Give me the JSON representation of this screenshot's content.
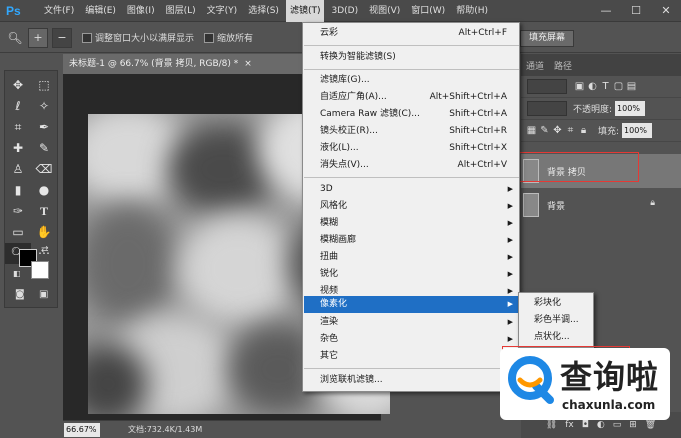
{
  "menubar": {
    "logo": "Ps",
    "items": [
      "文件(F)",
      "编辑(E)",
      "图像(I)",
      "图层(L)",
      "文字(Y)",
      "选择(S)",
      "滤镜(T)",
      "3D(D)",
      "视图(V)",
      "窗口(W)",
      "帮助(H)"
    ],
    "active_index": 6,
    "win_min": "—",
    "win_max": "☐",
    "win_close": "✕"
  },
  "optbar": {
    "resize_label": "调整窗口大小以满屏显示",
    "zoom_all_label": "缩放所有",
    "fill_screen": "填充屏幕"
  },
  "document": {
    "tab_title": "未标题-1 @ 66.7% (背景 拷贝, RGB/8) *",
    "tab_close": "×",
    "zoom": "66.67%",
    "info": "文档:732.4K/1.43M"
  },
  "panels": {
    "tabs": [
      "通道",
      "路径"
    ],
    "opacity_label": "不透明度:",
    "opacity_value": "100%",
    "fill_label": "填充:",
    "fill_value": "100%",
    "layers": [
      {
        "name": "背景 拷贝",
        "active": true
      },
      {
        "name": "背景",
        "active": false,
        "locked": true
      }
    ],
    "bottom_fx": "fx"
  },
  "filter_menu": {
    "items": [
      {
        "label": "云彩",
        "shortcut": "Alt+Ctrl+F"
      },
      {
        "label": "转换为智能滤镜(S)",
        "shortcut": ""
      },
      {
        "label": "滤镜库(G)...",
        "shortcut": ""
      },
      {
        "label": "自适应广角(A)...",
        "shortcut": "Alt+Shift+Ctrl+A"
      },
      {
        "label": "Camera Raw 滤镜(C)...",
        "shortcut": "Shift+Ctrl+A"
      },
      {
        "label": "镜头校正(R)...",
        "shortcut": "Shift+Ctrl+R"
      },
      {
        "label": "液化(L)...",
        "shortcut": "Shift+Ctrl+X"
      },
      {
        "label": "消失点(V)...",
        "shortcut": "Alt+Ctrl+V"
      },
      {
        "label": "3D",
        "sub": true
      },
      {
        "label": "风格化",
        "sub": true
      },
      {
        "label": "模糊",
        "sub": true
      },
      {
        "label": "模糊画廊",
        "sub": true
      },
      {
        "label": "扭曲",
        "sub": true
      },
      {
        "label": "锐化",
        "sub": true
      },
      {
        "label": "视频",
        "sub": true
      },
      {
        "label": "像素化",
        "sub": true,
        "highlight": true
      },
      {
        "label": "渲染",
        "sub": true
      },
      {
        "label": "杂色",
        "sub": true
      },
      {
        "label": "其它",
        "sub": true
      },
      {
        "label": "浏览联机滤镜...",
        "shortcut": ""
      }
    ]
  },
  "pixelate_submenu": {
    "items": [
      "彩块化",
      "彩色半调...",
      "点状化..."
    ]
  },
  "watermark": {
    "text": "查询啦",
    "url": "chaxunla.com"
  },
  "colors": {
    "highlight": "#1f6fc5",
    "ps_blue": "#31a8ff",
    "annotation_red": "#e53935",
    "watermark_blue": "#1e88e5",
    "watermark_orange": "#ff9800"
  }
}
